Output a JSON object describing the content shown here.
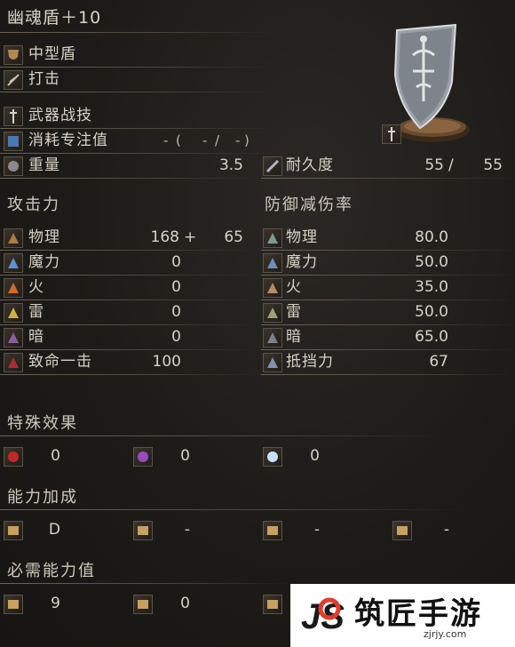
{
  "item": {
    "name": "幽魂盾＋10",
    "type": "中型盾",
    "attack_type": "打击",
    "skill": "武器战技",
    "fp_label": "消耗专注值",
    "fp_values": [
      "-",
      "(",
      "-",
      "/",
      "-",
      ")"
    ],
    "weight_label": "重量",
    "weight_value": "3.5",
    "durability_label": "耐久度",
    "durability_current": "55",
    "durability_sep": "/",
    "durability_max": "55"
  },
  "attack": {
    "title": "攻击力",
    "rows": [
      {
        "label": "物理",
        "value": "168",
        "plus": "+",
        "bonus": "65",
        "color": "#b07a3c"
      },
      {
        "label": "魔力",
        "value": "0",
        "color": "#5f8fd0"
      },
      {
        "label": "火",
        "value": "0",
        "color": "#d06a2c"
      },
      {
        "label": "雷",
        "value": "0",
        "color": "#d0b040"
      },
      {
        "label": "暗",
        "value": "0",
        "color": "#8a5fa0"
      },
      {
        "label": "致命一击",
        "value": "100",
        "color": "#a83030"
      }
    ]
  },
  "defense": {
    "title": "防御减伤率",
    "rows": [
      {
        "label": "物理",
        "value": "80.0",
        "color": "#7c9a90"
      },
      {
        "label": "魔力",
        "value": "50.0",
        "color": "#6a8fb8"
      },
      {
        "label": "火",
        "value": "35.0",
        "color": "#b88a60"
      },
      {
        "label": "雷",
        "value": "50.0",
        "color": "#a0a070"
      },
      {
        "label": "暗",
        "value": "65.0",
        "color": "#7a8090"
      },
      {
        "label": "抵挡力",
        "value": "67",
        "color": "#8090b0"
      }
    ]
  },
  "effects": {
    "title": "特殊效果",
    "items": [
      {
        "value": "0",
        "color": "#c02828"
      },
      {
        "value": "0",
        "color": "#9a4ac0"
      },
      {
        "value": "0",
        "color": "#c8e0ff"
      }
    ]
  },
  "scaling": {
    "title": "能力加成",
    "items": [
      "D",
      "-",
      "-",
      "-"
    ]
  },
  "requirements": {
    "title": "必需能力值",
    "items": [
      "9",
      "0"
    ]
  },
  "watermark": {
    "brand": "筑匠手游",
    "url": "zjrjy.com",
    "logo": "JS"
  }
}
